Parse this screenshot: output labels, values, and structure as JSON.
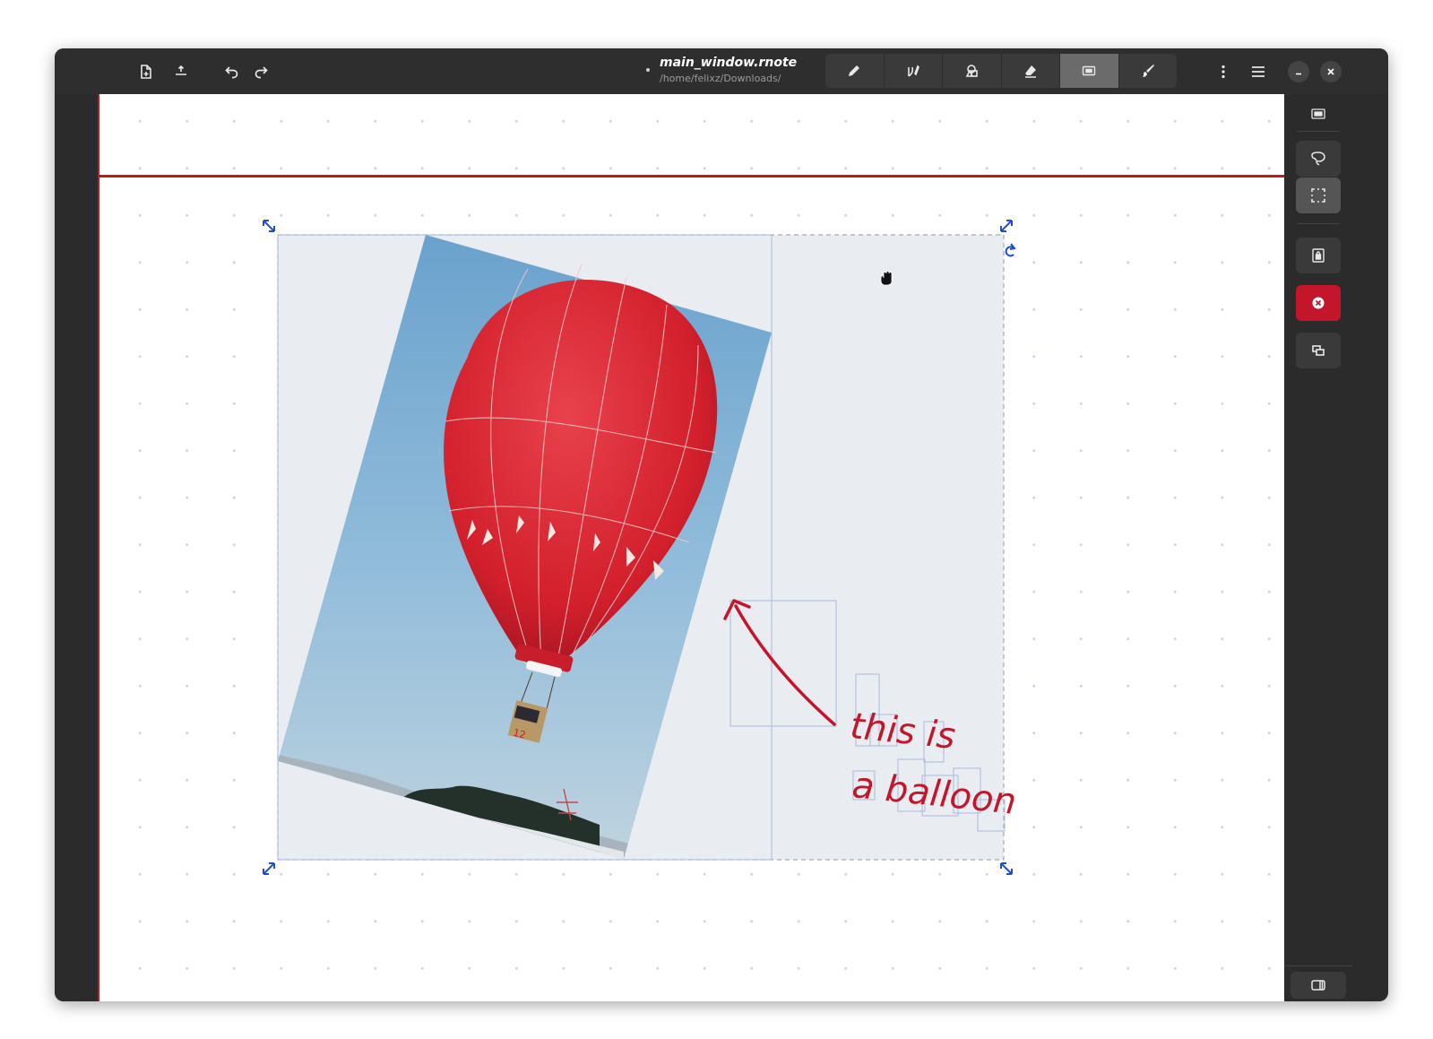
{
  "document": {
    "title": "main_window.rnote",
    "path": "/home/felixz/Downloads/"
  },
  "header": {
    "left_buttons": [
      "new-document-icon",
      "export-icon",
      "undo-icon",
      "redo-icon"
    ],
    "tools": [
      {
        "name": "pen",
        "icon": "pencil-icon",
        "active": false
      },
      {
        "name": "shaper",
        "icon": "shaper-icon",
        "active": false
      },
      {
        "name": "typewriter",
        "icon": "shapes-icon",
        "active": false
      },
      {
        "name": "eraser",
        "icon": "eraser-icon",
        "active": false
      },
      {
        "name": "selector",
        "icon": "selector-icon",
        "active": true
      },
      {
        "name": "tools",
        "icon": "brush-icon",
        "active": false
      }
    ],
    "right_buttons": [
      "more-options-icon",
      "main-menu-icon",
      "minimize-icon",
      "close-icon"
    ]
  },
  "side_panel": {
    "items": [
      {
        "icon": "selector-mode-icon",
        "active": false
      },
      {
        "icon": "lasso-icon",
        "active": false
      },
      {
        "icon": "rectangle-select-icon",
        "active": true
      },
      {
        "icon": "lock-select-icon",
        "active": false
      },
      {
        "icon": "delete-selection-icon",
        "active": false
      },
      {
        "icon": "duplicate-selection-icon",
        "active": false
      },
      {
        "icon": "toggle-sidebar-icon",
        "active": false
      }
    ]
  },
  "canvas": {
    "handwritten_annotation": [
      "this is",
      "a balloon"
    ],
    "balloon_number": "12",
    "accent_color": "#c4162a",
    "selection_color": "#1c4fd4"
  }
}
